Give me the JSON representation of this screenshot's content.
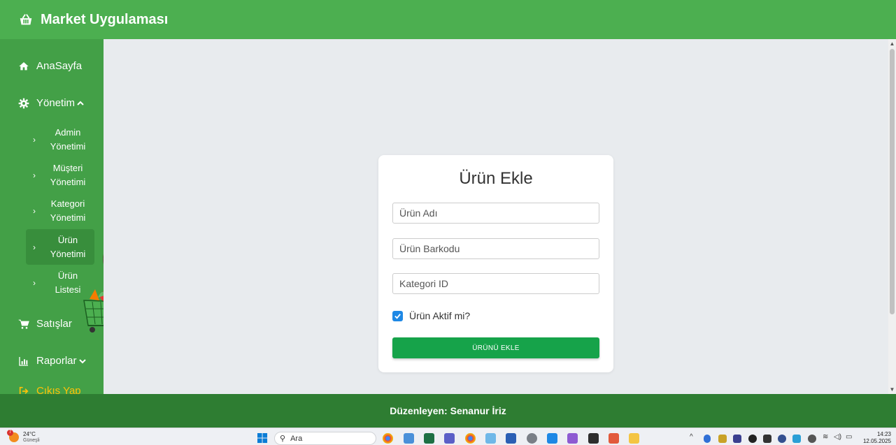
{
  "header": {
    "app_title": "Market Uygulaması",
    "logo_icon": "shopping-basket-icon"
  },
  "sidebar": {
    "home": {
      "label": "AnaSayfa",
      "icon": "home-icon"
    },
    "management": {
      "label": "Yönetim",
      "icon": "gear-icon",
      "expanded": true
    },
    "sub_items": [
      {
        "line1": "Admin",
        "line2": "Yönetimi"
      },
      {
        "line1": "Müşteri",
        "line2": "Yönetimi"
      },
      {
        "line1": "Kategori",
        "line2": "Yönetimi"
      },
      {
        "line1": "Ürün",
        "line2": "Yönetimi",
        "active": true
      },
      {
        "line1": "Ürün",
        "line2": "Listesi"
      }
    ],
    "sales": {
      "label": "Satışlar",
      "icon": "cart-icon"
    },
    "reports": {
      "label": "Raporlar",
      "icon": "bar-chart-icon"
    },
    "logout": {
      "label": "Çıkış Yap",
      "icon": "logout-icon",
      "color": "#ffc107"
    }
  },
  "form": {
    "title": "Ürün Ekle",
    "product_name_placeholder": "Ürün Adı",
    "barcode_placeholder": "Ürün Barkodu",
    "category_placeholder": "Kategori ID",
    "active_label": "Ürün Aktif mi?",
    "active_checked": true,
    "submit_label": "ÜRÜNÜ EKLE"
  },
  "footer": {
    "text": "Düzenleyen: Senanur İriz"
  },
  "taskbar": {
    "weather_temp": "24°C",
    "weather_cond": "Güneşli",
    "weather_badge": "7",
    "search_label": "Ara",
    "time": "14:23",
    "date": "12.05.2025"
  },
  "colors": {
    "header": "#4caf50",
    "sidebar": "#43a047",
    "sidebar_active": "#388e3c",
    "footer": "#2e7d32",
    "button": "#16a34a",
    "checkbox": "#1e88e5"
  }
}
